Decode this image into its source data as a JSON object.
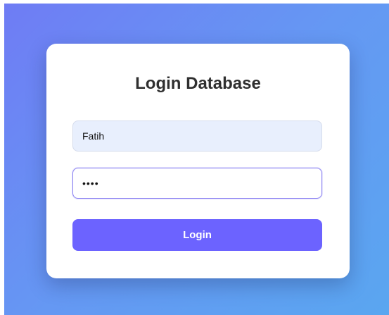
{
  "login": {
    "title": "Login Database",
    "username_value": "Fatih",
    "password_value": "••••",
    "button_label": "Login"
  },
  "colors": {
    "accent": "#6c63ff",
    "background_start": "#6f7cf4",
    "background_end": "#5aa6f0",
    "username_fill": "#e8effd"
  }
}
